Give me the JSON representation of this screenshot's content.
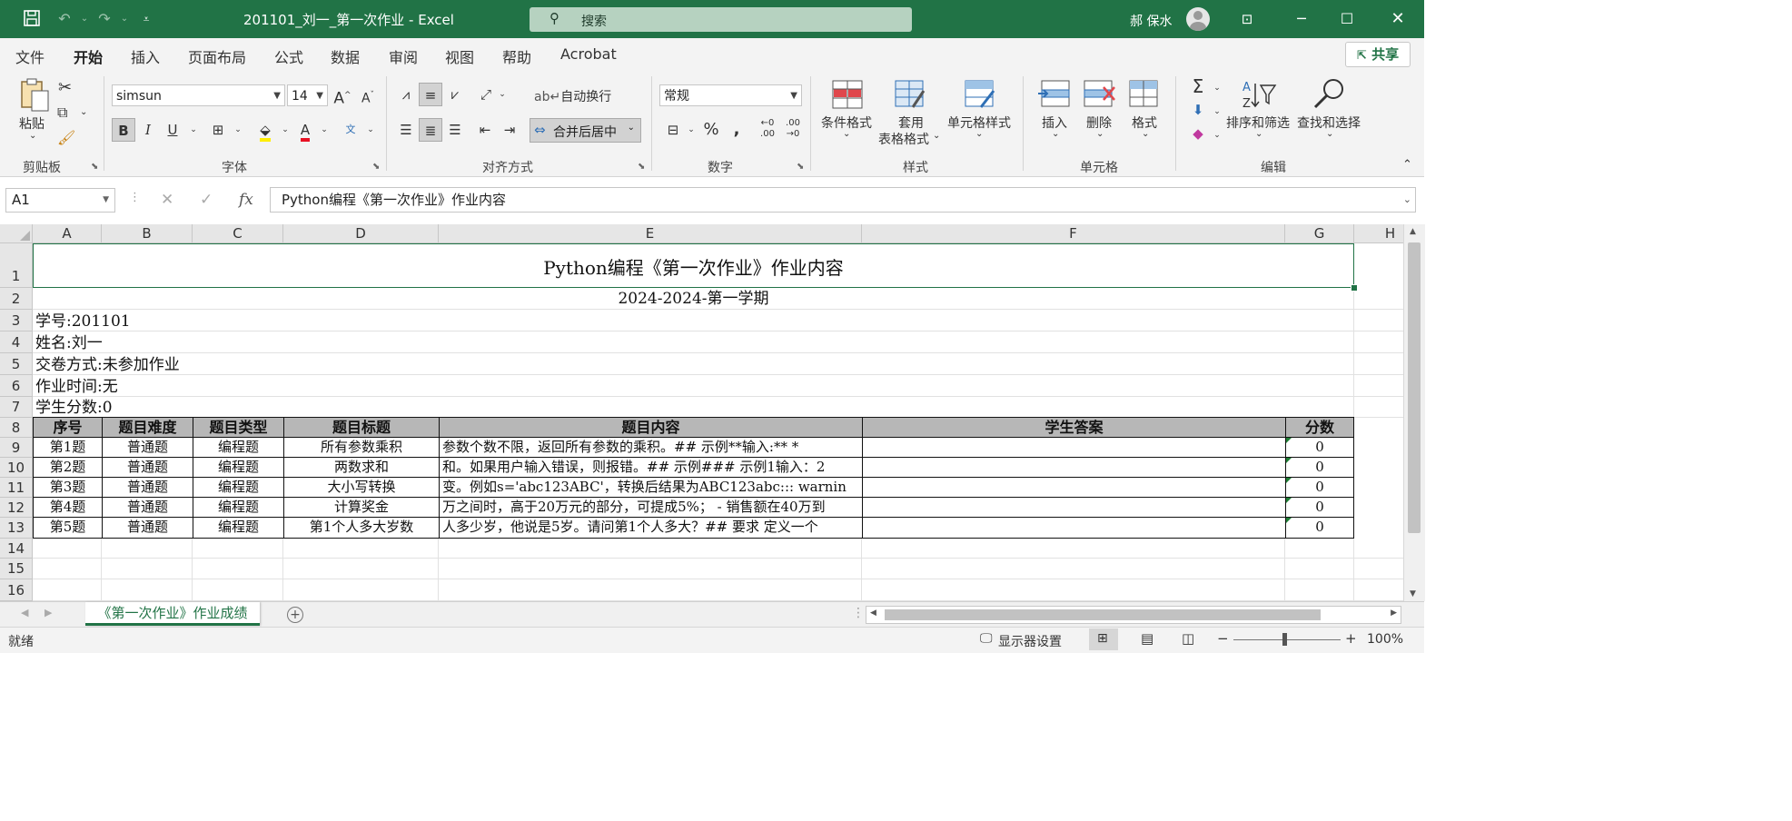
{
  "titlebar": {
    "doc_title": "201101_刘一_第一次作业 - Excel",
    "search_placeholder": "搜索",
    "user_name": "郝 保水"
  },
  "menu": {
    "tabs": [
      "文件",
      "开始",
      "插入",
      "页面布局",
      "公式",
      "数据",
      "审阅",
      "视图",
      "帮助",
      "Acrobat"
    ],
    "active": "开始",
    "share_label": "共享"
  },
  "ribbon": {
    "clipboard": {
      "paste": "粘贴",
      "group": "剪贴板"
    },
    "font": {
      "name": "simsun",
      "size": "14",
      "group": "字体"
    },
    "alignment": {
      "wrap": "自动换行",
      "merge": "合并后居中",
      "group": "对齐方式"
    },
    "number": {
      "format": "常规",
      "group": "数字"
    },
    "styles": {
      "conditional": "条件格式",
      "table_line1": "套用",
      "table_line2": "表格格式",
      "cell_styles": "单元格样式",
      "group": "样式"
    },
    "cells": {
      "insert": "插入",
      "delete": "删除",
      "format": "格式",
      "group": "单元格"
    },
    "editing": {
      "sort": "排序和筛选",
      "find": "查找和选择",
      "group": "编辑"
    }
  },
  "formula_bar": {
    "name_box": "A1",
    "content": "Python编程《第一次作业》作业内容"
  },
  "grid": {
    "columns": [
      "A",
      "B",
      "C",
      "D",
      "E",
      "F",
      "G",
      "H"
    ],
    "rows": [
      "1",
      "2",
      "3",
      "4",
      "5",
      "6",
      "7",
      "8",
      "9",
      "10",
      "11",
      "12",
      "13",
      "14",
      "15",
      "16"
    ],
    "title": "Python编程《第一次作业》作业内容",
    "semester": "2024-2024-第一学期",
    "info": [
      "学号:201101",
      "姓名:刘一",
      "交卷方式:未参加作业",
      "作业时间:无",
      "学生分数:0"
    ],
    "table_headers": [
      "序号",
      "题目难度",
      "题目类型",
      "题目标题",
      "题目内容",
      "学生答案",
      "分数"
    ],
    "table_rows": [
      [
        "第1题",
        "普通题",
        "编程题",
        "所有参数乘积",
        "参数个数不限，返回所有参数的乘积。## 示例**输入:** *",
        "",
        "0"
      ],
      [
        "第2题",
        "普通题",
        "编程题",
        "两数求和",
        "和。如果用户输入错误，则报错。## 示例### 示例1输入：2",
        "",
        "0"
      ],
      [
        "第3题",
        "普通题",
        "编程题",
        "大小写转换",
        "变。例如s='abc123ABC'，转换后结果为ABC123abc::: warnin",
        "",
        "0"
      ],
      [
        "第4题",
        "普通题",
        "编程题",
        "计算奖金",
        "万之间时，高于20万元的部分，可提成5%； - 销售额在40万到",
        "",
        "0"
      ],
      [
        "第5题",
        "普通题",
        "编程题",
        "第1个人多大岁数",
        "人多少岁，他说是5岁。请问第1个人多大？## 要求 定义一个",
        "",
        "0"
      ]
    ]
  },
  "sheet_tab": "《第一次作业》作业成绩",
  "status": {
    "ready": "就绪",
    "display_settings": "显示器设置",
    "zoom": "100%"
  },
  "colors": {
    "accent": "#217346",
    "header_fill": "#b7b7b7"
  }
}
